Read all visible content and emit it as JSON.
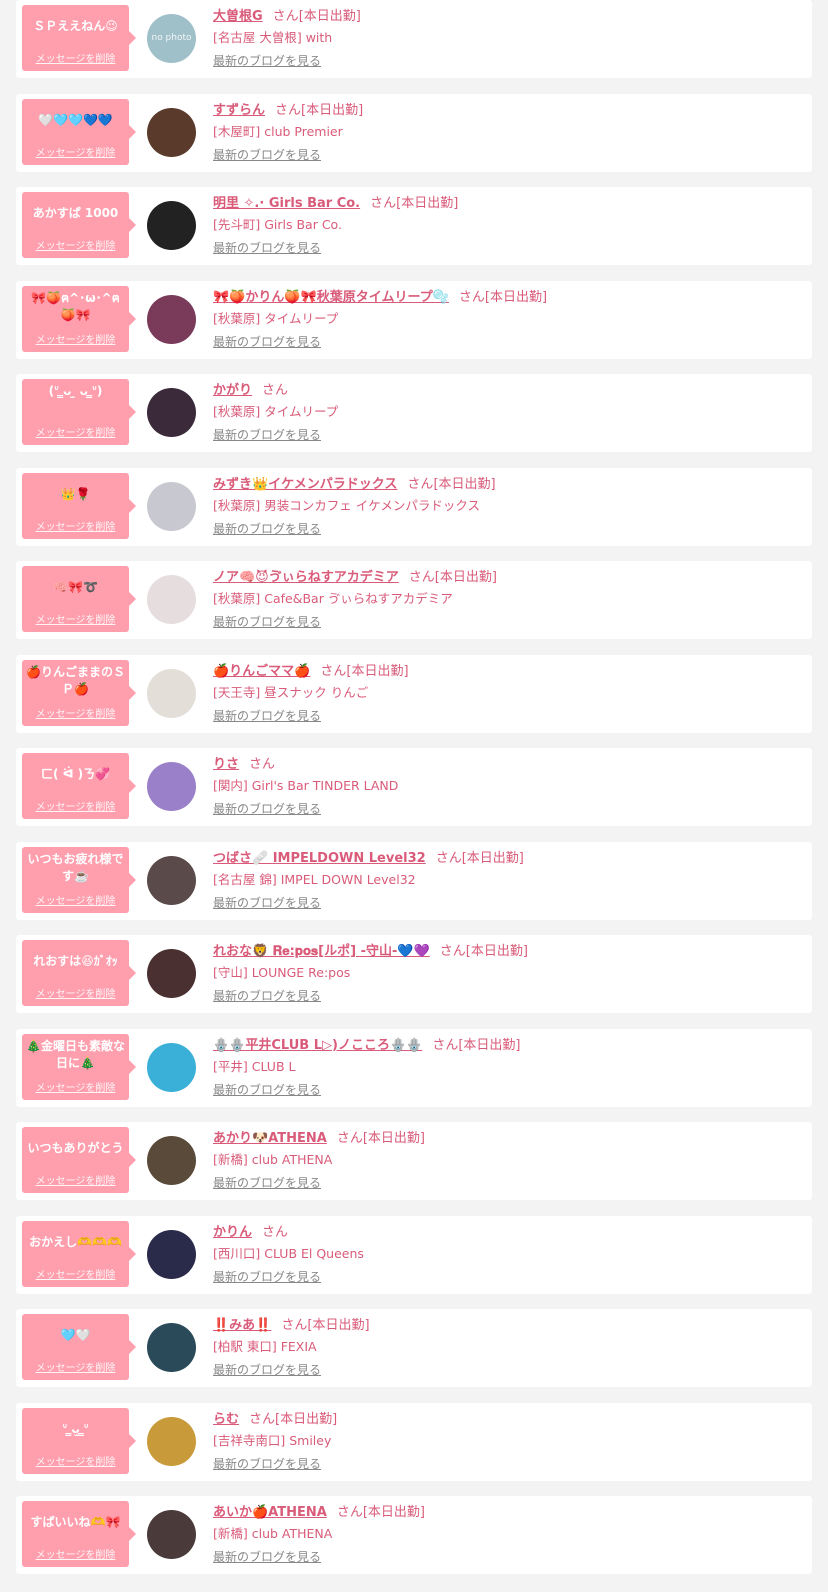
{
  "messages": [
    {
      "bubble": "ＳＰええねん😉👍",
      "delete": "メッセージを削除",
      "avatar_text": "no photo",
      "avatar_color": "#9fbfc9",
      "name": "大曽根G",
      "san": "さん",
      "shift": "[本日出勤]",
      "shop": "[名古屋 大曽根] with",
      "blog": "最新のブログを見る"
    },
    {
      "bubble": "🤍🩵🩵💙💙",
      "delete": "メッセージを削除",
      "avatar_text": "",
      "avatar_color": "#5a3a2a",
      "name": "すずらん",
      "san": "さん",
      "shift": "[本日出勤]",
      "shop": "[木屋町] club Premier",
      "blog": "最新のブログを見る"
    },
    {
      "bubble": "あかすぱ 1000",
      "delete": "メッセージを削除",
      "avatar_text": "",
      "avatar_color": "#222222",
      "name": "明里 ✧.· Girls Bar Co.",
      "san": "さん",
      "shift": "[本日出勤]",
      "shop": "[先斗町] Girls Bar Co.",
      "blog": "最新のブログを見る"
    },
    {
      "bubble": "🎀🍑ฅ^･ω･^ฅ🍑🎀",
      "delete": "メッセージを削除",
      "avatar_text": "",
      "avatar_color": "#7a3a5a",
      "name": "🎀🍑かりん🍑🎀秋葉原タイムリープ🫧",
      "san": "さん",
      "shift": "[本日出勤]",
      "shop": "[秋葉原] タイムリープ",
      "blog": "最新のブログを見る"
    },
    {
      "bubble": "(ᐡ ̳ᴗ  ̫ ᴗ ̳ᐡ)",
      "delete": "メッセージを削除",
      "avatar_text": "",
      "avatar_color": "#3a2a3a",
      "name": "かがり",
      "san": "さん",
      "shift": "",
      "shop": "[秋葉原] タイムリープ",
      "blog": "最新のブログを見る"
    },
    {
      "bubble": "👑🌹",
      "delete": "メッセージを削除",
      "avatar_text": "",
      "avatar_color": "#c8c8d0",
      "name": "みずき👑イケメンパラドックス",
      "san": "さん",
      "shift": "[本日出勤]",
      "shop": "[秋葉原] 男装コンカフェ イケメンパラドックス",
      "blog": "最新のブログを見る"
    },
    {
      "bubble": "🧠🎀➰",
      "delete": "メッセージを削除",
      "avatar_text": "",
      "avatar_color": "#e6dede",
      "name": "ノア🧠😈ゔぃらねすアカデミア",
      "san": "さん",
      "shift": "[本日出勤]",
      "shop": "[秋葉原] Cafe&Bar ゔぃらねすアカデミア",
      "blog": "最新のブログを見る"
    },
    {
      "bubble": "🍎りんごままのＳＰ🍎",
      "delete": "メッセージを削除",
      "avatar_text": "",
      "avatar_color": "#e3ded8",
      "name": "🍎りんごママ🍎",
      "san": "さん",
      "shift": "[本日出勤]",
      "shop": "[天王寺] 昼スナック りんご",
      "blog": "最新のブログを見る"
    },
    {
      "bubble": "ㄈ( ᐛ )ㄋ💞",
      "delete": "メッセージを削除",
      "avatar_text": "",
      "avatar_color": "#9a80c8",
      "name": "りさ",
      "san": "さん",
      "shift": "",
      "shop": "[関内] Girl's Bar TINDER LAND",
      "blog": "最新のブログを見る"
    },
    {
      "bubble": "いつもお疲れ様です☕️",
      "delete": "メッセージを削除",
      "avatar_text": "",
      "avatar_color": "#5a4a4a",
      "name": "つばさ🩹 IMPELDOWN Level32",
      "san": "さん",
      "shift": "[本日出勤]",
      "shop": "[名古屋 錦] IMPEL DOWN Level32",
      "blog": "最新のブログを見る"
    },
    {
      "bubble": "れおすは😆ｶﾞｵｯ",
      "delete": "メッセージを削除",
      "avatar_text": "",
      "avatar_color": "#4a3030",
      "name": "れおな🦁 𝐑𝐞:𝐩𝐨𝐬[ルポ] -守山-💙💜",
      "san": "さん",
      "shift": "[本日出勤]",
      "shop": "[守山] LOUNGE Re:pos",
      "blog": "最新のブログを見る"
    },
    {
      "bubble": "🎄金曜日も素敵な日に🎄",
      "delete": "メッセージを削除",
      "avatar_text": "",
      "avatar_color": "#3ab0d8",
      "name": "🪬🪬平井CLUB L▷)ノこころ🪬🪬",
      "san": "さん",
      "shift": "[本日出勤]",
      "shop": "[平井] CLUB L",
      "blog": "最新のブログを見る"
    },
    {
      "bubble": "いつもありがとう🥰",
      "delete": "メッセージを削除",
      "avatar_text": "",
      "avatar_color": "#5a4a3a",
      "name": "あかり🐶ATHENA",
      "san": "さん",
      "shift": "[本日出勤]",
      "shop": "[新橋] club ATHENA",
      "blog": "最新のブログを見る"
    },
    {
      "bubble": "おかえし🫶🫶🫶",
      "delete": "メッセージを削除",
      "avatar_text": "",
      "avatar_color": "#2a2a4a",
      "name": "かりん",
      "san": "さん",
      "shift": "",
      "shop": "[西川口] CLUB El Queens",
      "blog": "最新のブログを見る"
    },
    {
      "bubble": "🩵🤍",
      "delete": "メッセージを削除",
      "avatar_text": "",
      "avatar_color": "#2a4a5a",
      "name": "‼️みあ‼️",
      "san": "さん",
      "shift": "[本日出勤]",
      "shop": "[柏駅 東口] FEXIA",
      "blog": "最新のブログを見る"
    },
    {
      "bubble": "ᐡ ̳ᴗ̫ ̳ᐡ",
      "delete": "メッセージを削除",
      "avatar_text": "",
      "avatar_color": "#c89a3a",
      "name": "らむ",
      "san": "さん",
      "shift": "[本日出勤]",
      "shop": "[吉祥寺南口] Smiley",
      "blog": "最新のブログを見る"
    },
    {
      "bubble": "すぱいいね🫶🎀🍎",
      "delete": "メッセージを削除",
      "avatar_text": "",
      "avatar_color": "#4a3a3a",
      "name": "あいか🍎ATHENA",
      "san": "さん",
      "shift": "[本日出勤]",
      "shop": "[新橋] club ATHENA",
      "blog": "最新のブログを見る"
    }
  ]
}
